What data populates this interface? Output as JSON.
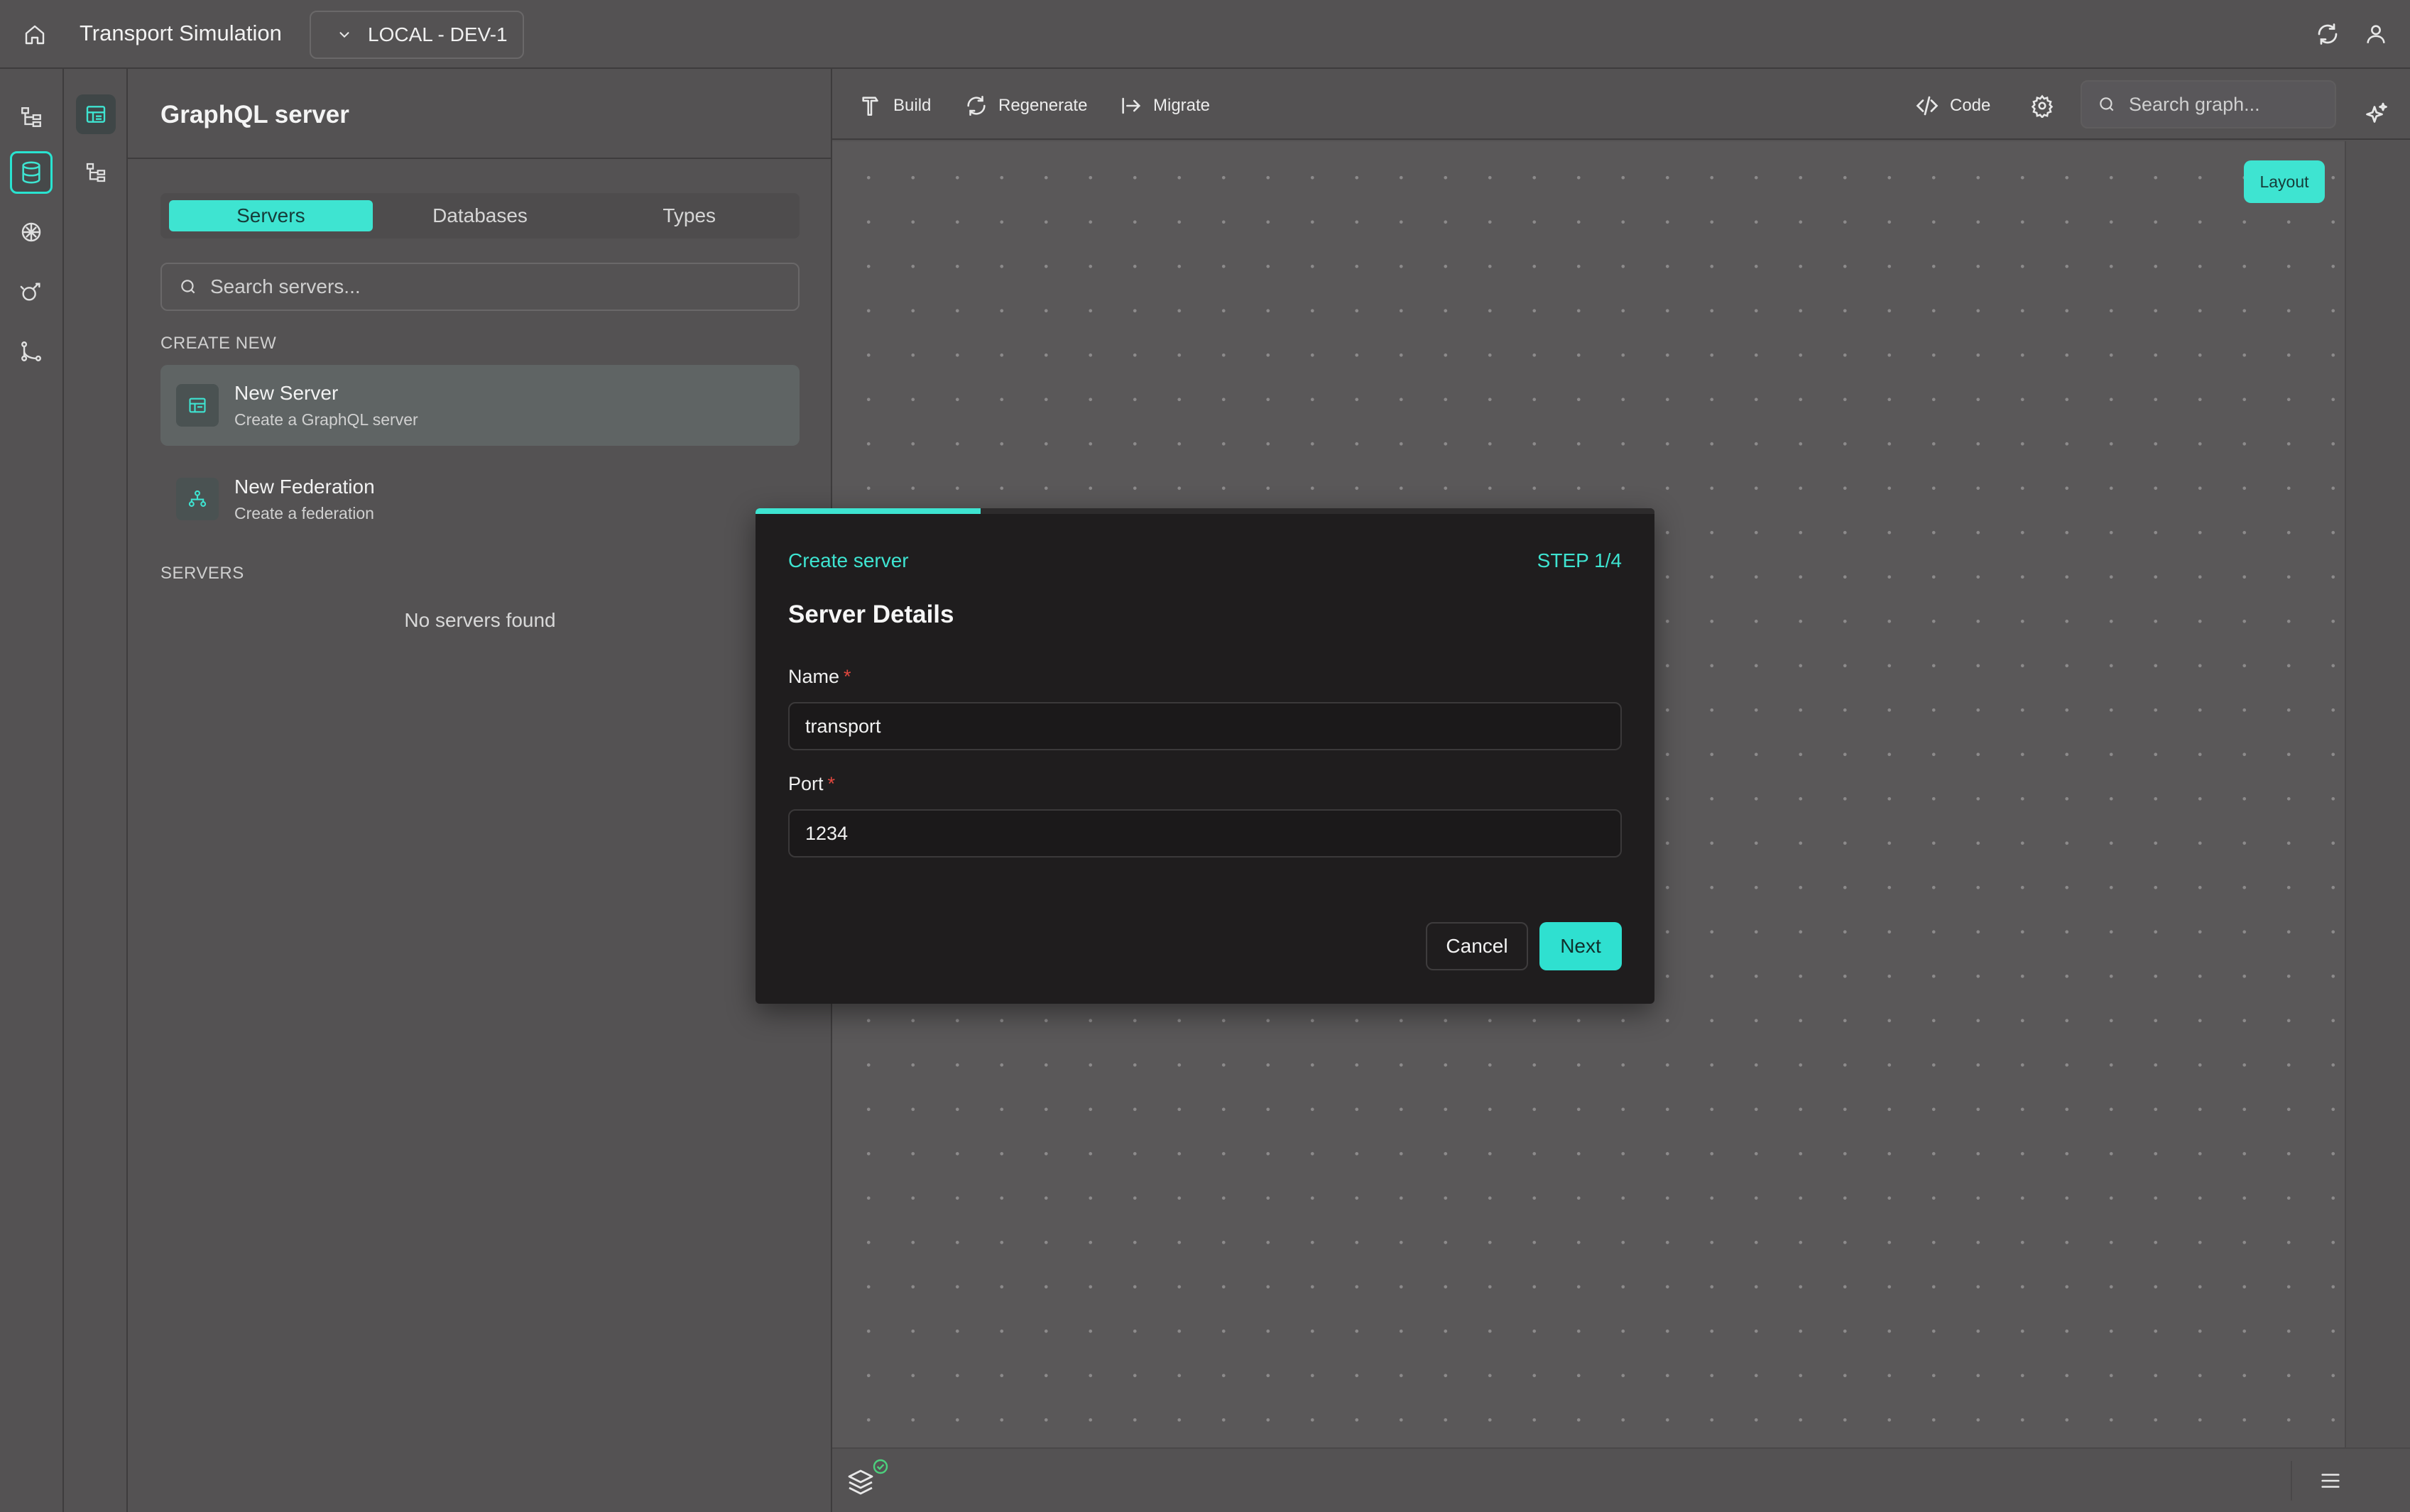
{
  "app": {
    "title": "Transport Simulation",
    "environment": "LOCAL - DEV-1"
  },
  "rail": {
    "items": [
      "schema-tree-icon",
      "database-icon",
      "brain-icon",
      "pipeline-icon",
      "git-branch-icon"
    ],
    "active": "database-icon"
  },
  "rail2": {
    "items": [
      "server-list-icon",
      "hierarchy-icon"
    ],
    "active": "server-list-icon"
  },
  "panel": {
    "title": "GraphQL server",
    "tabs": [
      {
        "label": "Servers",
        "active": true
      },
      {
        "label": "Databases",
        "active": false
      },
      {
        "label": "Types",
        "active": false
      }
    ],
    "search_placeholder": "Search servers...",
    "create_new_label": "CREATE NEW",
    "create_items": [
      {
        "title": "New Server",
        "subtitle": "Create a GraphQL server",
        "icon": "server-icon"
      },
      {
        "title": "New Federation",
        "subtitle": "Create a federation",
        "icon": "federation-icon"
      }
    ],
    "servers_label": "SERVERS",
    "empty_text": "No servers found"
  },
  "toolbar": {
    "build": "Build",
    "regenerate": "Regenerate",
    "migrate": "Migrate",
    "code": "Code",
    "search_placeholder": "Search graph..."
  },
  "canvas": {
    "layout_button": "Layout"
  },
  "modal": {
    "eyebrow": "Create server",
    "step": "STEP 1/4",
    "progress": 0.25,
    "title": "Server Details",
    "name_label": "Name",
    "name_value": "transport",
    "port_label": "Port",
    "port_value": "1234",
    "required_mark": "*",
    "cancel": "Cancel",
    "next": "Next"
  },
  "colors": {
    "accent": "#3ee4d1",
    "background": "#545253",
    "modal_bg": "#1f1d1e",
    "required": "#e0473e"
  }
}
